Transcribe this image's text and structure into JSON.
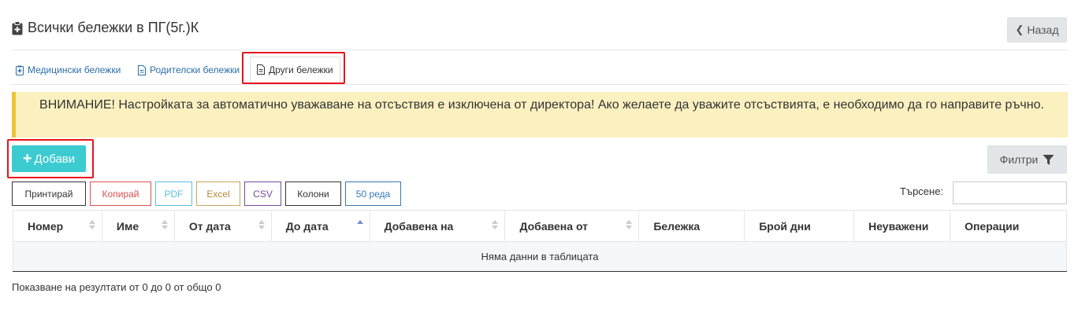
{
  "header": {
    "title": "Всички бележки в ПГ(5г.)К",
    "back_label": "Назад"
  },
  "tabs": [
    {
      "label": "Медицински бележки",
      "icon": "medical-note-icon",
      "active": false
    },
    {
      "label": "Родителски бележки",
      "icon": "document-icon",
      "active": false
    },
    {
      "label": "Други бележки",
      "icon": "document-icon",
      "active": true
    }
  ],
  "alert": {
    "text": "ВНИМАНИЕ! Настройката за автоматично уважаване на отсъствия е изключена от директора! Ако желаете да уважите отсъствията, е необходимо да го направите ръчно."
  },
  "toolbar": {
    "add_label": "Добави",
    "filter_label": "Филтри"
  },
  "export_buttons": [
    {
      "label": "Принтирай",
      "color": "#333333"
    },
    {
      "label": "Копирай",
      "color": "#d9534f"
    },
    {
      "label": "PDF",
      "color": "#5bc0de"
    },
    {
      "label": "Excel",
      "color": "#b58a3a"
    },
    {
      "label": "CSV",
      "color": "#7a4b9e"
    },
    {
      "label": "Колони",
      "color": "#333333"
    },
    {
      "label": "50 реда",
      "color": "#337ab7"
    }
  ],
  "search": {
    "label": "Търсене:",
    "value": "",
    "placeholder": ""
  },
  "table": {
    "columns": [
      "Номер",
      "Име",
      "От дата",
      "До дата",
      "Добавена на",
      "Добавена от",
      "Бележка",
      "Брой дни",
      "Неуважени",
      "Операции"
    ],
    "empty_text": "Няма данни в таблицата",
    "info": "Показване на резултати от 0 до 0 от общо 0"
  },
  "colors": {
    "accent": "#3ccbd0",
    "alert_bg": "#fbf0bf",
    "alert_border": "#f0c534",
    "highlight": "#e8121b",
    "link": "#2a6ea8"
  }
}
